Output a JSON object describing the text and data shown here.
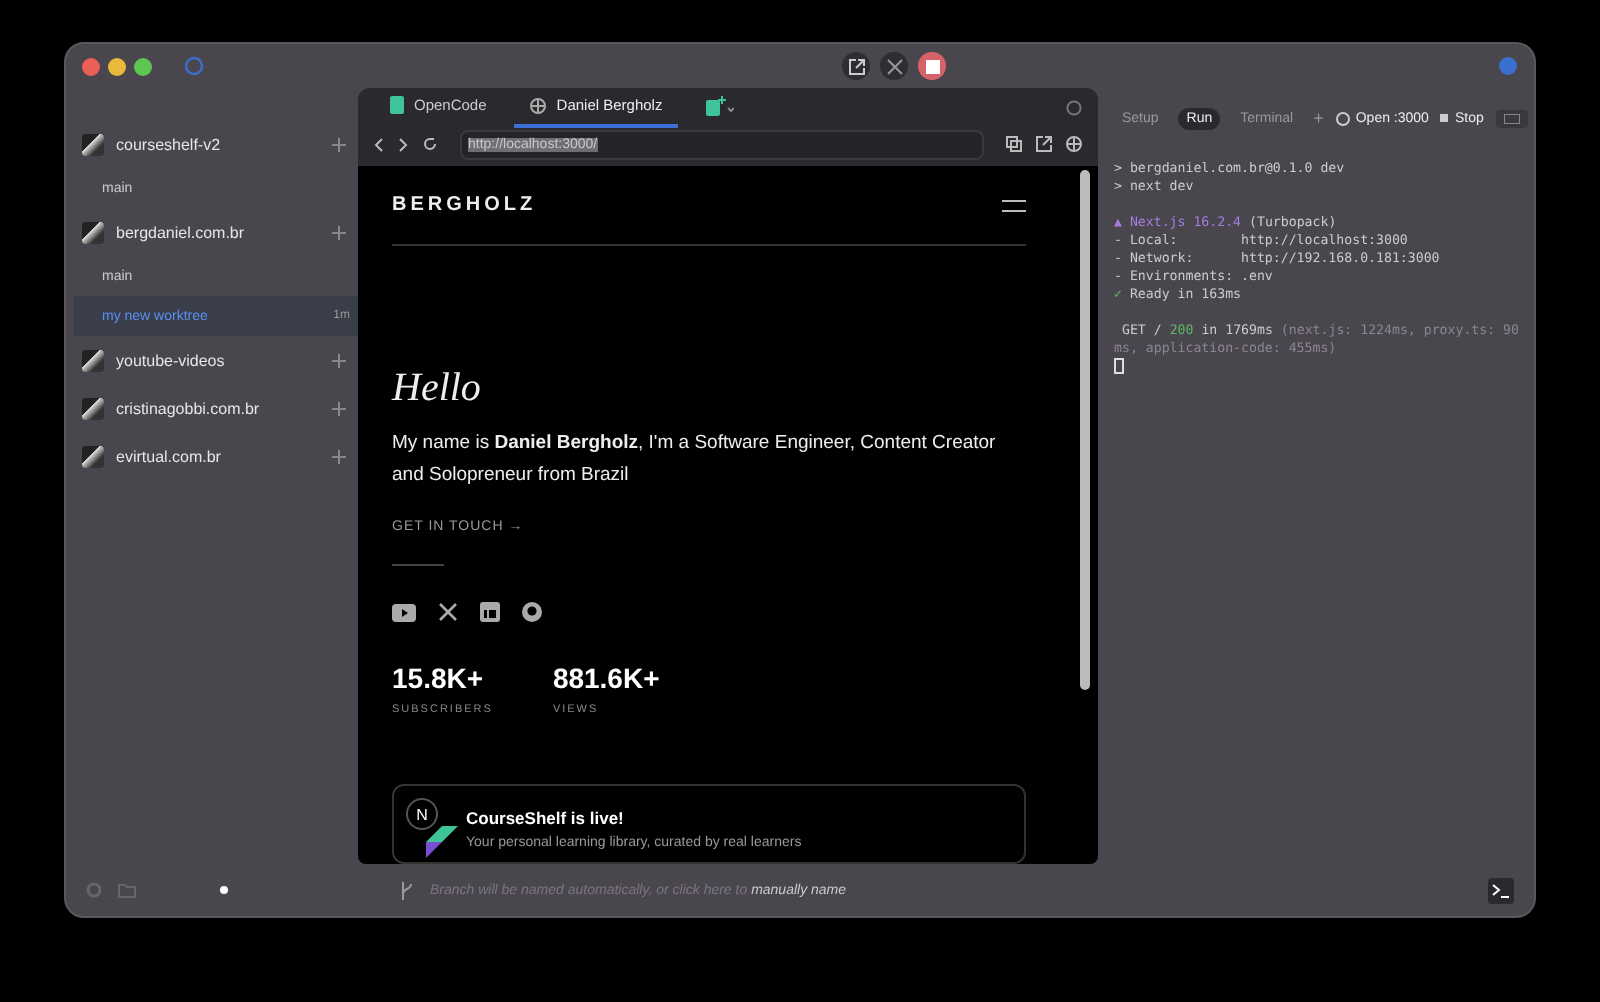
{
  "sidebar": {
    "projects": [
      {
        "name": "courseshelf-v2",
        "children": [
          {
            "name": "main",
            "selected": false
          }
        ]
      },
      {
        "name": "bergdaniel.com.br",
        "children": [
          {
            "name": "main",
            "selected": false
          },
          {
            "name": "my new worktree",
            "selected": true,
            "age": "1m"
          }
        ]
      },
      {
        "name": "youtube-videos"
      },
      {
        "name": "cristinagobbi.com.br"
      },
      {
        "name": "evirtual.com.br"
      }
    ]
  },
  "browser": {
    "tabs": [
      {
        "label": "OpenCode",
        "kind": "app",
        "selected": false
      },
      {
        "label": "Daniel Bergholz",
        "kind": "web",
        "selected": true
      }
    ],
    "url": "http://localhost:3000/",
    "page": {
      "logo": "BERGHOLZ",
      "greeting": "Hello",
      "intro": "My name is **Daniel Bergholz**, I'm a Software Engineer, Content Creator and Solopreneur from Brazil",
      "cta": "GET IN TOUCH →",
      "stats": [
        {
          "value": "15.8K+",
          "label": "SUBSCRIBERS"
        },
        {
          "value": "881.6K+",
          "label": "VIEWS"
        }
      ],
      "card": {
        "badge": "N",
        "title": "CourseShelf is live!",
        "text": "Your personal learning library, curated by real learners"
      }
    }
  },
  "terminal": {
    "tabs": [
      {
        "label": "Setup",
        "selected": false
      },
      {
        "label": "Run",
        "selected": true
      },
      {
        "label": "Terminal",
        "selected": false
      }
    ],
    "add": "+",
    "open": "Open :3000",
    "stop": "Stop",
    "lines": [
      {
        "parts": [
          {
            "text": "> bergdaniel.com.br@0.1.0 dev",
            "kind": "plain"
          }
        ]
      },
      {
        "parts": [
          {
            "text": "> next dev",
            "kind": "plain"
          }
        ]
      },
      {
        "spaced": true,
        "parts": [
          {
            "text": "▲ Next.js 16.2.4",
            "kind": "purple"
          },
          {
            "text": " (Turbopack)",
            "kind": "plain"
          }
        ]
      },
      {
        "parts": [
          {
            "text": "- Local:        http://localhost:3000",
            "kind": "plain"
          }
        ]
      },
      {
        "parts": [
          {
            "text": "- Network:      http://192.168.0.181:3000",
            "kind": "plain"
          }
        ]
      },
      {
        "parts": [
          {
            "text": "- Environments: .env",
            "kind": "plain"
          }
        ]
      },
      {
        "parts": [
          {
            "text": "✓",
            "kind": "green"
          },
          {
            "text": " Ready in 163ms",
            "kind": "plain"
          }
        ]
      },
      {
        "spaced": true,
        "parts": [
          {
            "text": " GET / ",
            "kind": "plain"
          },
          {
            "text": "200",
            "kind": "green"
          },
          {
            "text": " in 1769ms ",
            "kind": "plain"
          },
          {
            "text": "(next.js: 1224ms, proxy.ts: 90ms, application-code: 455ms)",
            "kind": "dim"
          }
        ]
      }
    ]
  },
  "status_bar": {
    "hint": "Branch will be named automatically, or click here to",
    "link": "manually name"
  }
}
